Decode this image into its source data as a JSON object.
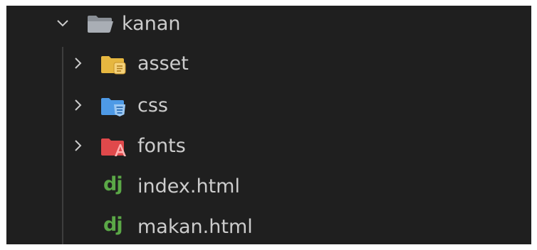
{
  "explorer": {
    "root": {
      "label": "kanan",
      "expanded": true,
      "icon": "folder-open-icon"
    },
    "children": [
      {
        "label": "asset",
        "kind": "folder",
        "icon": "folder-asset-icon",
        "color": "#e6b740"
      },
      {
        "label": "css",
        "kind": "folder",
        "icon": "folder-css-icon",
        "color": "#4e9ae6"
      },
      {
        "label": "fonts",
        "kind": "folder",
        "icon": "folder-fonts-icon",
        "color": "#e0494b"
      },
      {
        "label": "index.html",
        "kind": "file",
        "icon": "django-file-icon",
        "icon_text": "dj",
        "color": "#5ba847"
      },
      {
        "label": "makan.html",
        "kind": "file",
        "icon": "django-file-icon",
        "icon_text": "dj",
        "color": "#5ba847"
      }
    ]
  },
  "colors": {
    "background": "#1f1f1f",
    "text": "#cccccc",
    "guide": "#3d3d3d"
  }
}
